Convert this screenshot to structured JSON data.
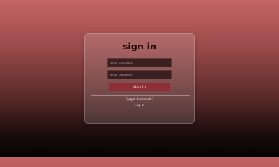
{
  "login_form": {
    "title": "sign in",
    "username_placeholder": "enter username",
    "password_placeholder": "enter password",
    "submit_label": "sign in",
    "forgot_password_label": "Forget Password ?",
    "login_link_label": "Log in"
  }
}
